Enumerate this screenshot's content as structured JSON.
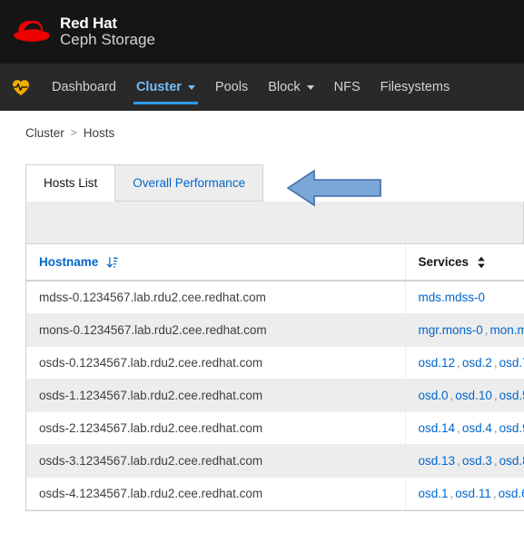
{
  "brand": {
    "logo_icon": "redhat-fedora-icon",
    "line1": "Red Hat",
    "line2": "Ceph Storage",
    "bg_color": "#151515",
    "logo_color": "#ee0000"
  },
  "nav": {
    "bg_color": "#292929",
    "active_color": "#73bcf7",
    "health_icon": "heart-pulse-icon",
    "health_icon_color": "#f0ab00",
    "items": [
      {
        "label": "Dashboard",
        "active": false,
        "has_caret": false
      },
      {
        "label": "Cluster",
        "active": true,
        "has_caret": true
      },
      {
        "label": "Pools",
        "active": false,
        "has_caret": false
      },
      {
        "label": "Block",
        "active": false,
        "has_caret": true
      },
      {
        "label": "NFS",
        "active": false,
        "has_caret": false
      },
      {
        "label": "Filesystems",
        "active": false,
        "has_caret": false
      }
    ]
  },
  "breadcrumb": {
    "parent": "Cluster",
    "separator": ">",
    "current": "Hosts"
  },
  "tabs": {
    "items": [
      {
        "label": "Hosts List",
        "active": true
      },
      {
        "label": "Overall Performance",
        "active": false
      }
    ]
  },
  "annotation": {
    "type": "left-arrow",
    "fill_color": "#7ba7d7",
    "stroke_color": "#3f6fa8",
    "points_at": "Overall Performance"
  },
  "table": {
    "columns": [
      {
        "label": "Hostname",
        "sorted": true,
        "sort_icon": "sort-amount-down-icon"
      },
      {
        "label": "Services",
        "sorted": false,
        "sort_icon": "sort-updown-icon"
      }
    ],
    "rows": [
      {
        "hostname": "mdss-0.1234567.lab.rdu2.cee.redhat.com",
        "services": [
          "mds.mdss-0"
        ]
      },
      {
        "hostname": "mons-0.1234567.lab.rdu2.cee.redhat.com",
        "services": [
          "mgr.mons-0",
          "mon.m"
        ]
      },
      {
        "hostname": "osds-0.1234567.lab.rdu2.cee.redhat.com",
        "services": [
          "osd.12",
          "osd.2",
          "osd.7"
        ]
      },
      {
        "hostname": "osds-1.1234567.lab.rdu2.cee.redhat.com",
        "services": [
          "osd.0",
          "osd.10",
          "osd.5"
        ]
      },
      {
        "hostname": "osds-2.1234567.lab.rdu2.cee.redhat.com",
        "services": [
          "osd.14",
          "osd.4",
          "osd.9"
        ]
      },
      {
        "hostname": "osds-3.1234567.lab.rdu2.cee.redhat.com",
        "services": [
          "osd.13",
          "osd.3",
          "osd.8"
        ]
      },
      {
        "hostname": "osds-4.1234567.lab.rdu2.cee.redhat.com",
        "services": [
          "osd.1",
          "osd.11",
          "osd.6"
        ]
      }
    ]
  }
}
